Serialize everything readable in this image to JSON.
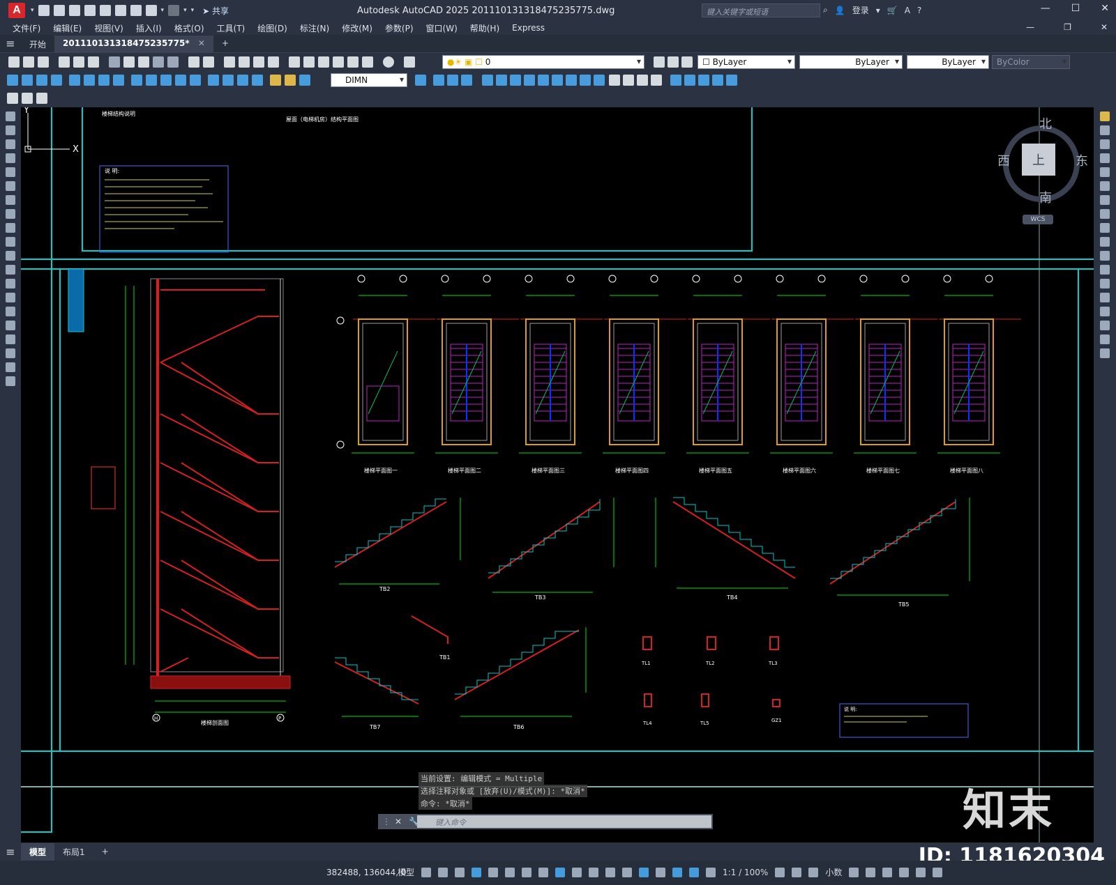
{
  "app": {
    "logo_letter": "A",
    "title": "Autodesk AutoCAD 2025   20111013131847523577​5.dwg",
    "search_placeholder": "键入关键字或短语",
    "share_label": "共享",
    "login_label": "登录"
  },
  "menu": [
    "文件(F)",
    "编辑(E)",
    "视图(V)",
    "插入(I)",
    "格式(O)",
    "工具(T)",
    "绘图(D)",
    "标注(N)",
    "修改(M)",
    "参数(P)",
    "窗口(W)",
    "帮助(H)",
    "Express"
  ],
  "tabs": {
    "start": "开始",
    "file": "20111013131847523577​5*"
  },
  "toolbar": {
    "layer_value": "0",
    "color_value": "ByLayer",
    "linetype_value": "ByLayer",
    "lineweight_value": "ByLayer",
    "plotstyle_value": "ByColor",
    "dimstyle_value": "DIMN"
  },
  "viewcube": {
    "north": "北",
    "south": "南",
    "east": "东",
    "west": "西",
    "top": "上",
    "wcs": "WCS"
  },
  "drawing": {
    "top_note_title": "屋面（电梯机房）结构平面图",
    "section_title": "楼梯剖面图",
    "plan_titles": [
      "楼梯平面图一",
      "楼梯平面图二",
      "楼梯平面图三",
      "楼梯平面图四",
      "楼梯平面图五",
      "楼梯平面图六",
      "楼梯平面图七",
      "楼梯平面图八"
    ],
    "run_titles": [
      "TB2",
      "TB3",
      "TB4",
      "TB5",
      "TB1",
      "TB7",
      "TB6"
    ],
    "beam_titles": [
      "TL1",
      "TL2",
      "TL3",
      "TL4",
      "TL5",
      "GZ1"
    ],
    "notes_title": "说 明:",
    "axis_a": "H",
    "axis_b": "P"
  },
  "ucs": {
    "x": "X",
    "y": "Y"
  },
  "command": {
    "history": [
      "当前设置: 编辑模式 = Multiple",
      "选择注释对象或 [放弃(U)/模式(M)]: *取消*",
      "命令: *取消*"
    ],
    "placeholder": "键入命令"
  },
  "watermark": {
    "brand": "知末",
    "id": "ID: 1181620304"
  },
  "layout_tabs": [
    "模型",
    "布局1"
  ],
  "status": {
    "coords": "382488, 136044, 0",
    "model": "模型",
    "scale": "1:1 / 100%",
    "units": "小数"
  }
}
